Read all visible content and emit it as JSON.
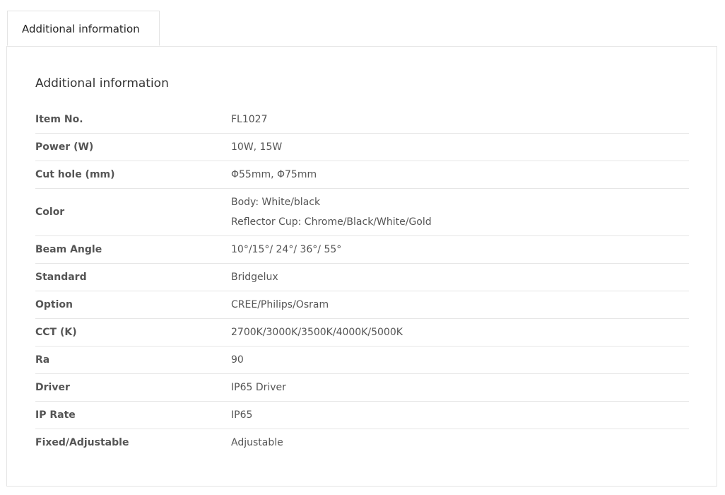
{
  "tabs": [
    {
      "label": "Additional information"
    }
  ],
  "panel": {
    "title": "Additional information",
    "rows": [
      {
        "label": "Item No.",
        "values": [
          "FL1027"
        ]
      },
      {
        "label": "Power (W)",
        "values": [
          "10W, 15W"
        ]
      },
      {
        "label": "Cut hole (mm)",
        "values": [
          "Φ55mm, Φ75mm"
        ]
      },
      {
        "label": "Color",
        "values": [
          "Body: White/black",
          "Reflector Cup: Chrome/Black/White/Gold"
        ]
      },
      {
        "label": "Beam Angle",
        "values": [
          "10°/15°/ 24°/ 36°/ 55°"
        ]
      },
      {
        "label": "Standard",
        "values": [
          "Bridgelux"
        ]
      },
      {
        "label": "Option",
        "values": [
          "CREE/Philips/Osram"
        ]
      },
      {
        "label": "CCT (K)",
        "values": [
          "2700K/3000K/3500K/4000K/5000K"
        ]
      },
      {
        "label": "Ra",
        "values": [
          "90"
        ]
      },
      {
        "label": "Driver",
        "values": [
          "IP65 Driver"
        ]
      },
      {
        "label": "IP Rate",
        "values": [
          "IP65"
        ]
      },
      {
        "label": "Fixed/Adjustable",
        "values": [
          "Adjustable"
        ]
      }
    ]
  }
}
